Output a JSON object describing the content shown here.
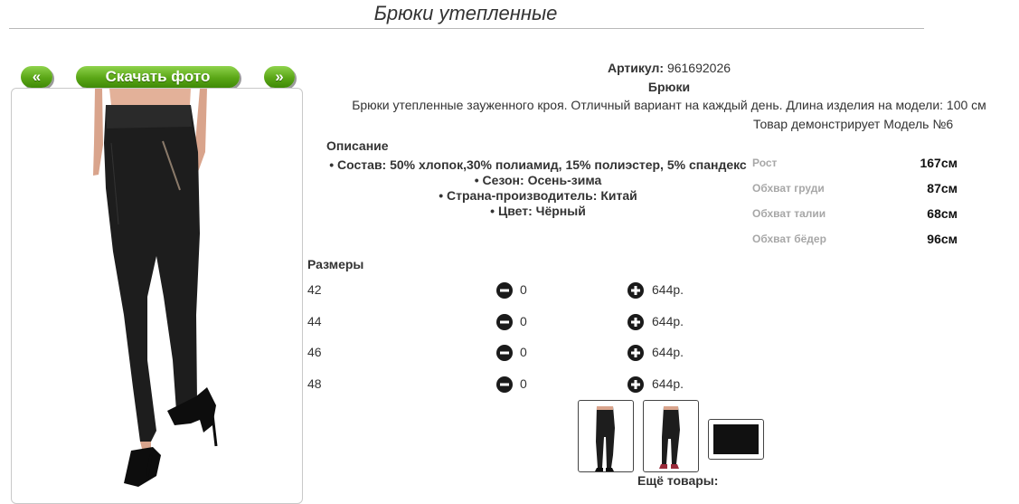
{
  "page": {
    "title": "Брюки утепленные"
  },
  "photo_nav": {
    "prev_label": "«",
    "download_label": "Скачать фото",
    "next_label": "»"
  },
  "product": {
    "article_label": "Артикул:",
    "article_value": "961692026",
    "category": "Брюки",
    "description": "Брюки утепленные зауженного кроя. Отличный вариант на каждый день. Длина изделия на модели: 100 см",
    "model_note": "Товар демонстрирует Модель №6"
  },
  "details": {
    "heading": "Описание",
    "items": [
      "Состав: 50% хлопок,30% полиамид, 15% полиэстер, 5% спандекс",
      "Сезон: Осень-зима",
      "Страна-производитель: Китай",
      "Цвет: Чёрный"
    ]
  },
  "model": {
    "params": [
      {
        "label": "Рост",
        "value": "167см"
      },
      {
        "label": "Обхват груди",
        "value": "87см"
      },
      {
        "label": "Обхват талии",
        "value": "68см"
      },
      {
        "label": "Обхват бёдер",
        "value": "96см"
      }
    ]
  },
  "sizes": {
    "heading": "Размеры",
    "rows": [
      {
        "size": "42",
        "qty": "0",
        "price": "644р."
      },
      {
        "size": "44",
        "qty": "0",
        "price": "644р."
      },
      {
        "size": "46",
        "qty": "0",
        "price": "644р."
      },
      {
        "size": "48",
        "qty": "0",
        "price": "644р."
      }
    ]
  },
  "more": {
    "label": "Ещё товары:"
  },
  "colors": {
    "accent_green": "#5aa616",
    "garment": "#1d1d1d",
    "label_grey": "#a7a7a7"
  },
  "icons": {
    "minus": "minus-circle-icon",
    "plus": "plus-circle-icon"
  }
}
